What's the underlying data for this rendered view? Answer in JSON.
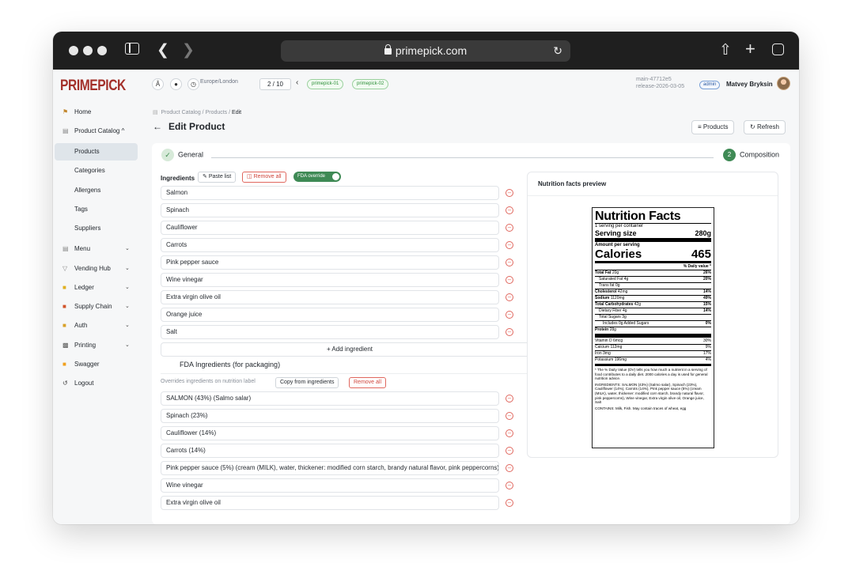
{
  "browser": {
    "url": "primepick.com"
  },
  "app": {
    "logo": "PRIMEPICK",
    "timezone": "Europe/London",
    "pager": "2 / 10",
    "chips": [
      "primepick-01",
      "primepick-02"
    ],
    "build": "main-47712e5",
    "release": "release-2026-03-05",
    "role": "admin",
    "user": "Matvey Bryksin"
  },
  "sidebar": {
    "items": [
      {
        "label": "Home",
        "icon": "home-icon"
      },
      {
        "label": "Product Catalog ^",
        "icon": "catalog-icon"
      },
      {
        "label": "Products"
      },
      {
        "label": "Categories"
      },
      {
        "label": "Allergens"
      },
      {
        "label": "Tags"
      },
      {
        "label": "Suppliers"
      },
      {
        "label": "Menu",
        "icon": "menu-icon"
      },
      {
        "label": "Vending Hub",
        "icon": "vending-icon"
      },
      {
        "label": "Ledger",
        "icon": "ledger-icon"
      },
      {
        "label": "Supply Chain",
        "icon": "truck-icon"
      },
      {
        "label": "Auth",
        "icon": "key-icon"
      },
      {
        "label": "Printing",
        "icon": "printer-icon"
      },
      {
        "label": "Swagger",
        "icon": "swagger-icon"
      },
      {
        "label": "Logout",
        "icon": "logout-icon"
      }
    ]
  },
  "page": {
    "breadcrumb": [
      "Product Catalog",
      "Products",
      "Edit"
    ],
    "title": "Edit Product",
    "products_btn": "Products",
    "refresh_btn": "Refresh"
  },
  "steps": {
    "step1": "General",
    "step2_num": "2",
    "step2": "Composition"
  },
  "ingredients": {
    "heading": "Ingredients",
    "paste": "Paste list",
    "remove_all": "Remove all",
    "fda_override": "FDA override",
    "items": [
      "Salmon",
      "Spinach",
      "Cauliflower",
      "Carrots",
      "Pink pepper sauce",
      "Wine vinegar",
      "Extra virgin olive oil",
      "Orange juice",
      "Salt"
    ],
    "add": "+ Add ingredient"
  },
  "fda": {
    "title": "FDA Ingredients (for packaging)",
    "note": "Overrides ingredients on nutrition label",
    "copy": "Copy from ingredients",
    "remove_all": "Remove all",
    "items": [
      "SALMON (43%) (Salmo salar)",
      "Spinach (23%)",
      "Cauliflower (14%)",
      "Carrots (14%)",
      "Pink pepper sauce (5%) (cream (MILK), water, thickener: modified corn starch, brandy natural flavor, pink peppercorns)",
      "Wine vinegar",
      "Extra virgin olive oil"
    ]
  },
  "preview": {
    "title": "Nutrition facts preview"
  },
  "nutrition": {
    "title": "Nutrition Facts",
    "servings": "1 serving per container",
    "serving_label": "Serving size",
    "serving_value": "280g",
    "amount": "Amount per serving",
    "calories_label": "Calories",
    "calories_value": "465",
    "dv_header": "% Daily value *",
    "rows": [
      {
        "label": "Total Fat",
        "amt": "20g",
        "dv": "26%",
        "bold": true,
        "indent": 0
      },
      {
        "label": "Saturated Fat",
        "amt": "4g",
        "dv": "20%",
        "bold": false,
        "indent": 1
      },
      {
        "label": "Trans fat",
        "amt": "0g",
        "dv": "",
        "bold": false,
        "indent": 1
      },
      {
        "label": "Cholesterol",
        "amt": "42mg",
        "dv": "14%",
        "bold": true,
        "indent": 0
      },
      {
        "label": "Sodium",
        "amt": "1120mg",
        "dv": "49%",
        "bold": true,
        "indent": 0
      },
      {
        "label": "Total Carbohydrates",
        "amt": "42g",
        "dv": "15%",
        "bold": true,
        "indent": 0
      },
      {
        "label": "Dietary Fiber",
        "amt": "4g",
        "dv": "14%",
        "bold": false,
        "indent": 1
      },
      {
        "label": "Total Sugars",
        "amt": "3g",
        "dv": "",
        "bold": false,
        "indent": 1
      },
      {
        "label": "Includes 0g Added Sugars",
        "amt": "",
        "dv": "0%",
        "bold": false,
        "indent": 2
      },
      {
        "label": "Protein",
        "amt": "28g",
        "dv": "",
        "bold": true,
        "indent": 0
      }
    ],
    "vitamins": [
      {
        "label": "Vitamin D 6mcg",
        "dv": "30%"
      },
      {
        "label": "Calcium 112mg",
        "dv": "9%"
      },
      {
        "label": "Iron 3mg",
        "dv": "17%"
      },
      {
        "label": "Potassium 196mg",
        "dv": "4%"
      }
    ],
    "footnote": "* The % Daily Value (DV) tells you how much a nutrient in a serving of food contributes to a daily diet. 2000 calories a day is used for general nutrition advice.",
    "ingredients_text": "INGREDIENTS: SALMON (43%) (Salmo salar), Spinach (23%), Cauliflower (14%), Carrots (14%), Pink pepper sauce (5%) (cream (MILK), water, thickener: modified corn starch, brandy natural flavor, pink peppercorns), Wine vinegar, Extra virgin olive oil, Orange juice, Salt",
    "contains": "CONTAINS: Milk, Fish. May contain traces of wheat, egg"
  }
}
